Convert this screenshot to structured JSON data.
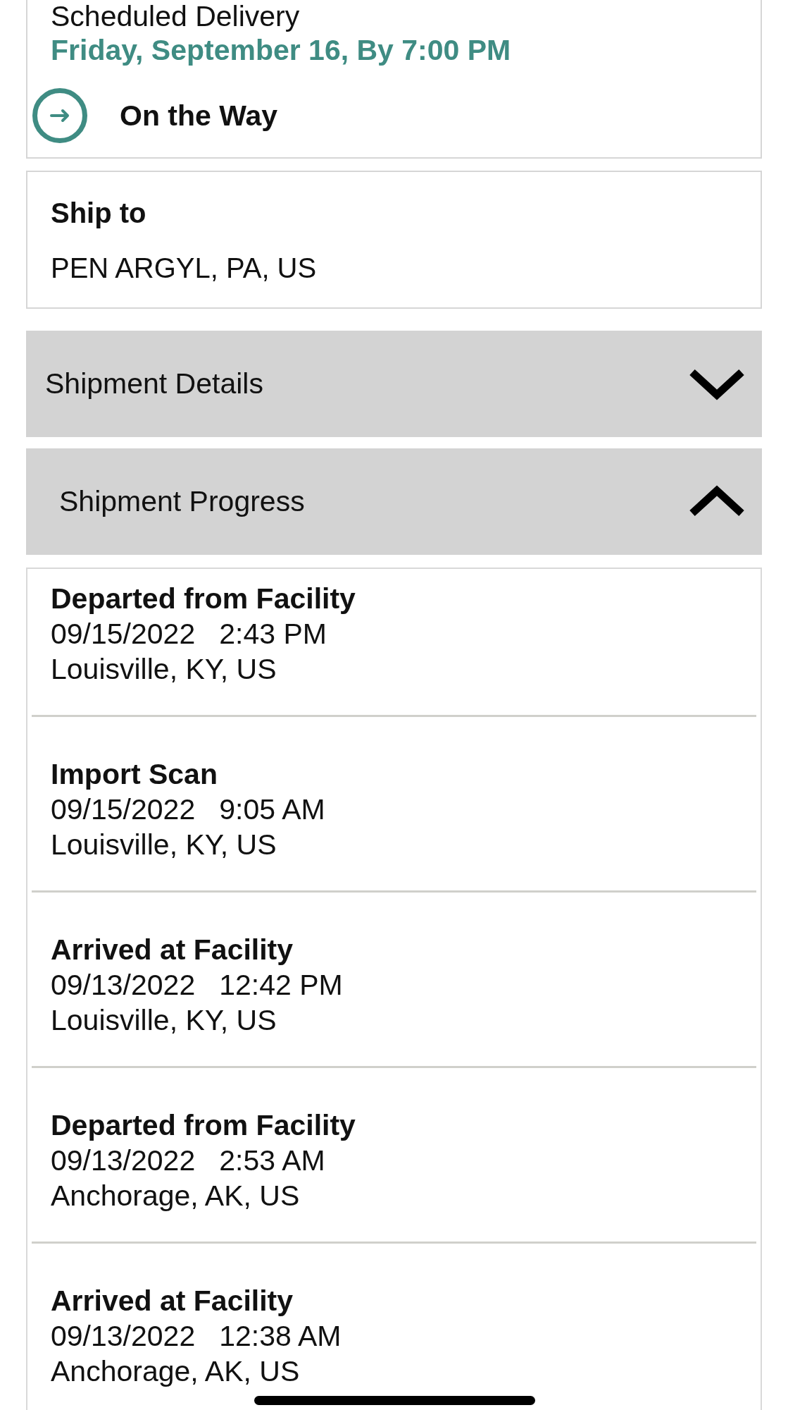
{
  "delivery": {
    "label": "Scheduled Delivery",
    "date": "Friday, September 16, By 7:00 PM",
    "status": "On the Way"
  },
  "ship_to": {
    "label": "Ship to",
    "address": "PEN ARGYL, PA, US"
  },
  "sections": [
    {
      "title": "Shipment Details",
      "expanded": false
    },
    {
      "title": "Shipment Progress",
      "expanded": true,
      "events": [
        {
          "status": "Departed from Facility",
          "date": "09/15/2022",
          "time": "2:43 PM",
          "location": "Louisville, KY, US"
        },
        {
          "status": "Import Scan",
          "date": "09/15/2022",
          "time": "9:05 AM",
          "location": "Louisville, KY, US"
        },
        {
          "status": "Arrived at Facility",
          "date": "09/13/2022",
          "time": "12:42 PM",
          "location": "Louisville, KY, US"
        },
        {
          "status": "Departed from Facility",
          "date": "09/13/2022",
          "time": "2:53 AM",
          "location": "Anchorage, AK, US"
        },
        {
          "status": "Arrived at Facility",
          "date": "09/13/2022",
          "time": "12:38 AM",
          "location": "Anchorage, AK, US"
        }
      ]
    }
  ]
}
